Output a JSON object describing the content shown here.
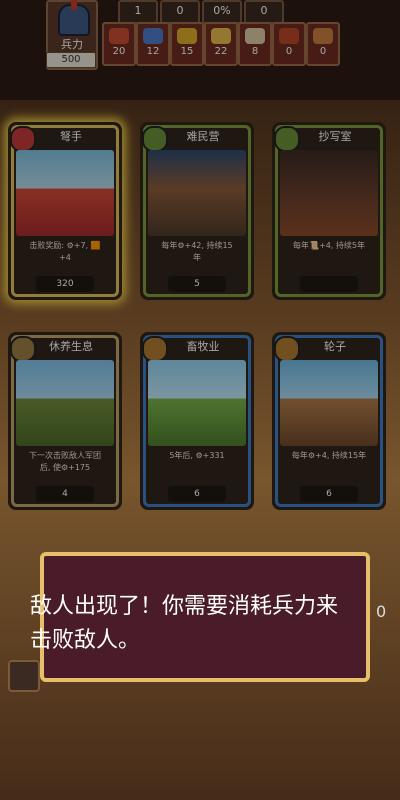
{
  "top": {
    "soldiers_label": "兵力",
    "soldiers_value": "500",
    "stats_top": [
      "1",
      "0",
      "0%",
      "0"
    ],
    "resources": [
      {
        "name": "meat",
        "value": "20",
        "color": "#c84b32"
      },
      {
        "name": "mushroom",
        "value": "12",
        "color": "#4d7ac8"
      },
      {
        "name": "corn",
        "value": "15",
        "color": "#d7a92a"
      },
      {
        "name": "gold",
        "value": "22",
        "color": "#e3b84b"
      },
      {
        "name": "scroll",
        "value": "8",
        "color": "#d9c6a4"
      },
      {
        "name": "bread",
        "value": "0",
        "color": "#b6472a"
      },
      {
        "name": "gear",
        "value": "0",
        "color": "#c67e3c"
      }
    ]
  },
  "cards": [
    {
      "title": "弩手",
      "desc": "击败奖励: ⚙+7, 🟧\n+4",
      "cost": "320",
      "highlight": true,
      "badge_color": "#c23b3b"
    },
    {
      "title": "难民营",
      "desc": "每年⚙+42, 持续15\n年",
      "cost": "5",
      "highlight": false,
      "badge_color": "#6b8f3a"
    },
    {
      "title": "抄写室",
      "desc": "每年📜+4, 持续5年",
      "cost": "",
      "highlight": false,
      "badge_color": "#6b8f3a"
    },
    {
      "title": "休养生息",
      "desc": "下一次击败敌人军团\n后, 使⚙+175",
      "cost": "4",
      "highlight": false,
      "badge_color": "#9a7c42"
    },
    {
      "title": "畜牧业",
      "desc": "5年后, ⚙+331",
      "cost": "6",
      "highlight": false,
      "badge_color": "#b07a2f"
    },
    {
      "title": "轮子",
      "desc": "每年⚙+4, 持续15年",
      "cost": "6",
      "highlight": false,
      "badge_color": "#b07a2f"
    }
  ],
  "dialog": {
    "text": "敌人出现了！你需要消耗兵力来击败敌人。"
  },
  "side_right": "0"
}
